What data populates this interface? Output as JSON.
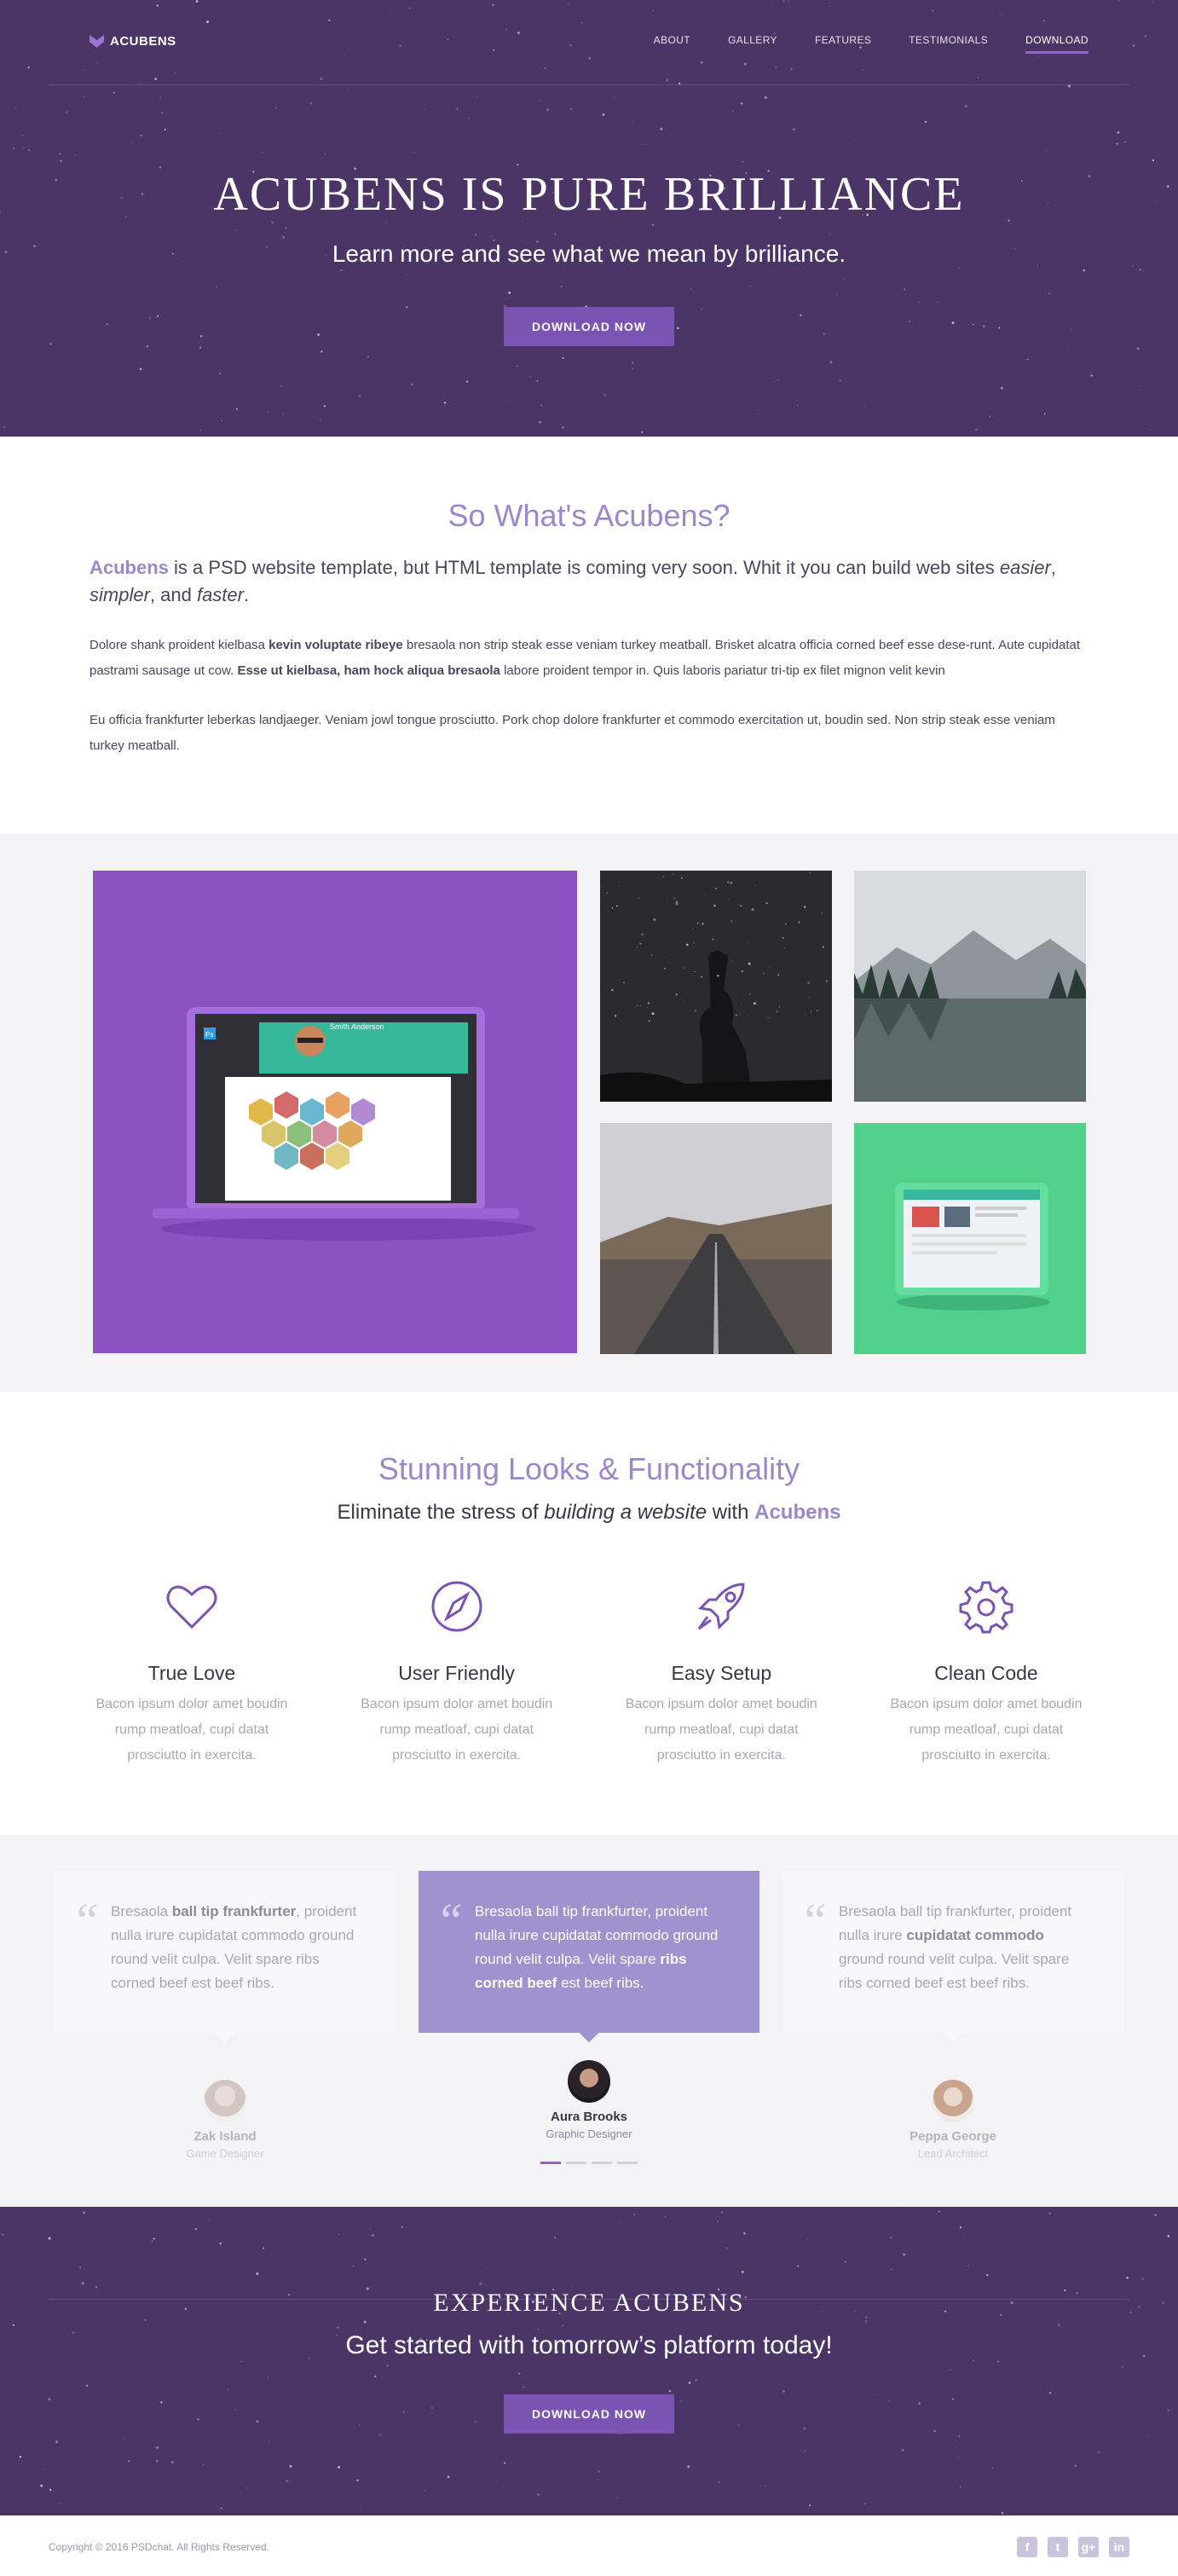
{
  "colors": {
    "hero_bg": "#4a3566",
    "accent": "#7b53b3",
    "brand_text": "#9b87c9",
    "gallery_bg": "#f3f3f5"
  },
  "nav": {
    "logo": "ACUBENS",
    "links": [
      "ABOUT",
      "GALLERY",
      "FEATURES",
      "TESTIMONIALS",
      "DOWNLOAD"
    ],
    "active": "DOWNLOAD"
  },
  "hero": {
    "title": "ACUBENS IS PURE BRILLIANCE",
    "subtitle": "Learn more and see what we mean by brilliance.",
    "button": "DOWNLOAD NOW"
  },
  "about": {
    "title": "So What's Acubens?",
    "lead_brand": "Acubens",
    "lead_text1": " is a PSD website template, but HTML template is coming very soon. Whit it you can build web sites ",
    "lead_em1": "easier",
    "lead_comma1": ", ",
    "lead_em2": "simpler",
    "lead_comma2": ", and ",
    "lead_em3": "faster",
    "lead_end": ".",
    "p1_a": "Dolore shank proident kielbasa ",
    "p1_b1": "kevin voluptate ribeye",
    "p1_c": " bresaola non strip steak esse veniam turkey meatball. Brisket alcatra officia corned beef esse dese-runt. Aute cupidatat pastrami sausage ut cow. ",
    "p1_b2": "Esse ut kielbasa, ham hock aliqua bresaola",
    "p1_d": " labore proident tempor in. Quis laboris pariatur tri-tip ex filet mignon velit kevin",
    "p2": "Eu officia frankfurter leberkas landjaeger. Veniam jowl tongue prosciutto. Pork chop dolore frankfurter et commodo exercitation ut, boudin sed. Non strip steak esse veniam turkey meatball."
  },
  "gallery": {
    "screen_title": "Smith Anderson",
    "ps_badge": "Ps",
    "tiles": [
      "laptop-mockup",
      "stargazing-photo",
      "lake-mountains-photo",
      "road-photo",
      "tablet-mockup"
    ]
  },
  "features": {
    "title": "Stunning Looks & Functionality",
    "sub_a": "Eliminate the stress of ",
    "sub_em": "building a website",
    "sub_b": " with ",
    "sub_brand": "Acubens",
    "items": [
      {
        "icon": "heart-icon",
        "title": "True Love",
        "text": "Bacon ipsum dolor amet boudin rump meatloaf, cupi datat prosciutto in exercita."
      },
      {
        "icon": "compass-icon",
        "title": "User Friendly",
        "text": "Bacon ipsum dolor amet boudin rump meatloaf, cupi datat prosciutto in exercita."
      },
      {
        "icon": "rocket-icon",
        "title": "Easy Setup",
        "text": "Bacon ipsum dolor amet boudin rump meatloaf, cupi datat prosciutto in exercita."
      },
      {
        "icon": "gear-icon",
        "title": "Clean Code",
        "text": "Bacon ipsum dolor amet boudin rump meatloaf, cupi datat prosciutto in exercita."
      }
    ]
  },
  "testimonials": {
    "quote_mark": "“",
    "cards": [
      {
        "a": "Bresaola ",
        "b": "ball tip frankfurter",
        "c": ", proident nulla irure cupidatat commodo ground round velit culpa. Velit spare ribs corned beef est beef ribs."
      },
      {
        "a": "Bresaola ball tip frankfurter, proident nulla irure cupidatat commodo ground round velit culpa. Velit spare ",
        "b": "ribs corned beef",
        "c": " est beef ribs."
      },
      {
        "a": "Bresaola ball tip frankfurter, proident nulla irure ",
        "b": "cupidatat commodo",
        "c": " ground round velit culpa. Velit spare ribs corned beef est beef ribs."
      }
    ],
    "people": [
      {
        "name": "Zak Island",
        "role": "Game Designer"
      },
      {
        "name": "Aura Brooks",
        "role": "Graphic Designer"
      },
      {
        "name": "Peppa George",
        "role": "Lead Architect"
      }
    ],
    "active_dot": 1,
    "dot_count": 4
  },
  "cta": {
    "title": "EXPERIENCE ACUBENS",
    "subtitle": "Get started with tomorrow’s platform today!",
    "button": "DOWNLOAD NOW"
  },
  "footer": {
    "copyright": "Copyright © 2016 PSDchat. All Rights Reserved.",
    "social": [
      {
        "icon": "facebook-icon",
        "glyph": "f"
      },
      {
        "icon": "twitter-icon",
        "glyph": "t"
      },
      {
        "icon": "google-plus-icon",
        "glyph": "g+"
      },
      {
        "icon": "linkedin-icon",
        "glyph": "in"
      }
    ]
  }
}
